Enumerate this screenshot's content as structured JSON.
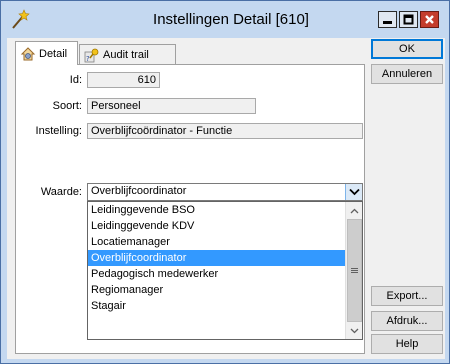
{
  "window": {
    "title": "Instellingen Detail [610]",
    "icons": {
      "app": "wand-icon",
      "minimize": "minimize-icon",
      "maximize": "maximize-icon",
      "close": "close-icon"
    }
  },
  "tabs": [
    {
      "label": "Detail",
      "icon": "house-gear-icon",
      "active": true
    },
    {
      "label": "Audit trail",
      "icon": "audit-key-icon",
      "active": false
    }
  ],
  "form": {
    "id_label": "Id:",
    "id_value": "610",
    "soort_label": "Soort:",
    "soort_value": "Personeel",
    "instelling_label": "Instelling:",
    "instelling_value": "Overblijfcoördinator - Functie",
    "waarde_label": "Waarde:",
    "waarde_value": "Overblijfcoordinator"
  },
  "dropdown": {
    "options": [
      "Leidinggevende BSO",
      "Leidinggevende KDV",
      "Locatiemanager",
      "Overblijfcoordinator",
      "Pedagogisch medewerker",
      "Regiomanager",
      "Stagair"
    ],
    "selected_index": 3
  },
  "buttons": {
    "ok": "OK",
    "annuleren": "Annuleren",
    "export": "Export...",
    "afdruk": "Afdruk...",
    "help": "Help"
  },
  "colors": {
    "selection": "#3399ff",
    "close_button": "#c43c2c",
    "title_bar": "#c4d8f0"
  }
}
